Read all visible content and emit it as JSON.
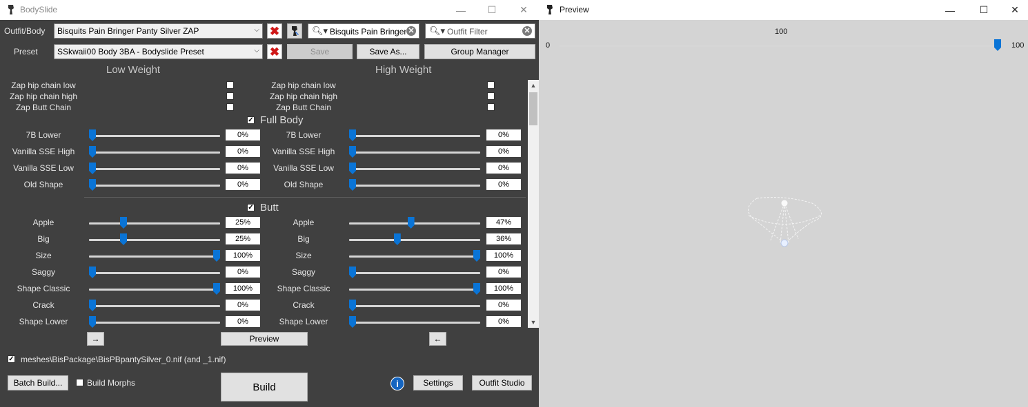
{
  "bodyslide": {
    "title": "BodySlide",
    "window_controls": {
      "minimize": "—",
      "maximize": "☐",
      "close": "✕"
    },
    "outfit_body_label": "Outfit/Body",
    "outfit_body_value": "Bisquits Pain Bringer Panty Silver ZAP",
    "preset_label": "Preset",
    "preset_value": "SSkwaii00 Body 3BA - Bodyslide Preset",
    "search_value": "Bisquits Pain Bringer",
    "outfit_filter_placeholder": "Outfit Filter",
    "save_label": "Save",
    "save_as_label": "Save As...",
    "group_manager_label": "Group Manager",
    "low_weight_label": "Low Weight",
    "high_weight_label": "High Weight",
    "zaps": [
      "Zap hip chain low",
      "Zap hip chain high",
      "Zap Butt Chain"
    ],
    "groups": [
      {
        "name": "Full Body",
        "checked": true,
        "sliders": [
          {
            "name": "7B Lower",
            "low": "0%",
            "high": "0%",
            "low_frac": 0,
            "high_frac": 0
          },
          {
            "name": "Vanilla SSE High",
            "low": "0%",
            "high": "0%",
            "low_frac": 0,
            "high_frac": 0
          },
          {
            "name": "Vanilla SSE Low",
            "low": "0%",
            "high": "0%",
            "low_frac": 0,
            "high_frac": 0
          },
          {
            "name": "Old Shape",
            "low": "0%",
            "high": "0%",
            "low_frac": 0,
            "high_frac": 0
          }
        ]
      },
      {
        "name": "Butt",
        "checked": true,
        "sliders": [
          {
            "name": "Apple",
            "low": "25%",
            "high": "47%",
            "low_frac": 0.25,
            "high_frac": 0.47
          },
          {
            "name": "Big",
            "low": "25%",
            "high": "36%",
            "low_frac": 0.25,
            "high_frac": 0.36
          },
          {
            "name": "Size",
            "low": "100%",
            "high": "100%",
            "low_frac": 1,
            "high_frac": 1
          },
          {
            "name": "Saggy",
            "low": "0%",
            "high": "0%",
            "low_frac": 0,
            "high_frac": 0
          },
          {
            "name": "Shape Classic",
            "low": "100%",
            "high": "100%",
            "low_frac": 1,
            "high_frac": 1
          },
          {
            "name": "Crack",
            "low": "0%",
            "high": "0%",
            "low_frac": 0,
            "high_frac": 0
          },
          {
            "name": "Shape Lower",
            "low": "0%",
            "high": "0%",
            "low_frac": 0,
            "high_frac": 0
          }
        ]
      }
    ],
    "arrow_right_label": "→",
    "arrow_left_label": "←",
    "preview_label": "Preview",
    "mesh_path": "meshes\\BisPackage\\BisPBpantySilver_0.nif (and _1.nif)",
    "batch_build_label": "Batch Build...",
    "build_morphs_label": "Build Morphs",
    "build_label": "Build",
    "settings_label": "Settings",
    "outfit_studio_label": "Outfit Studio"
  },
  "preview": {
    "title": "Preview",
    "slider_value": "100",
    "slider_min": "0",
    "slider_max": "100",
    "slider_frac": 1
  }
}
